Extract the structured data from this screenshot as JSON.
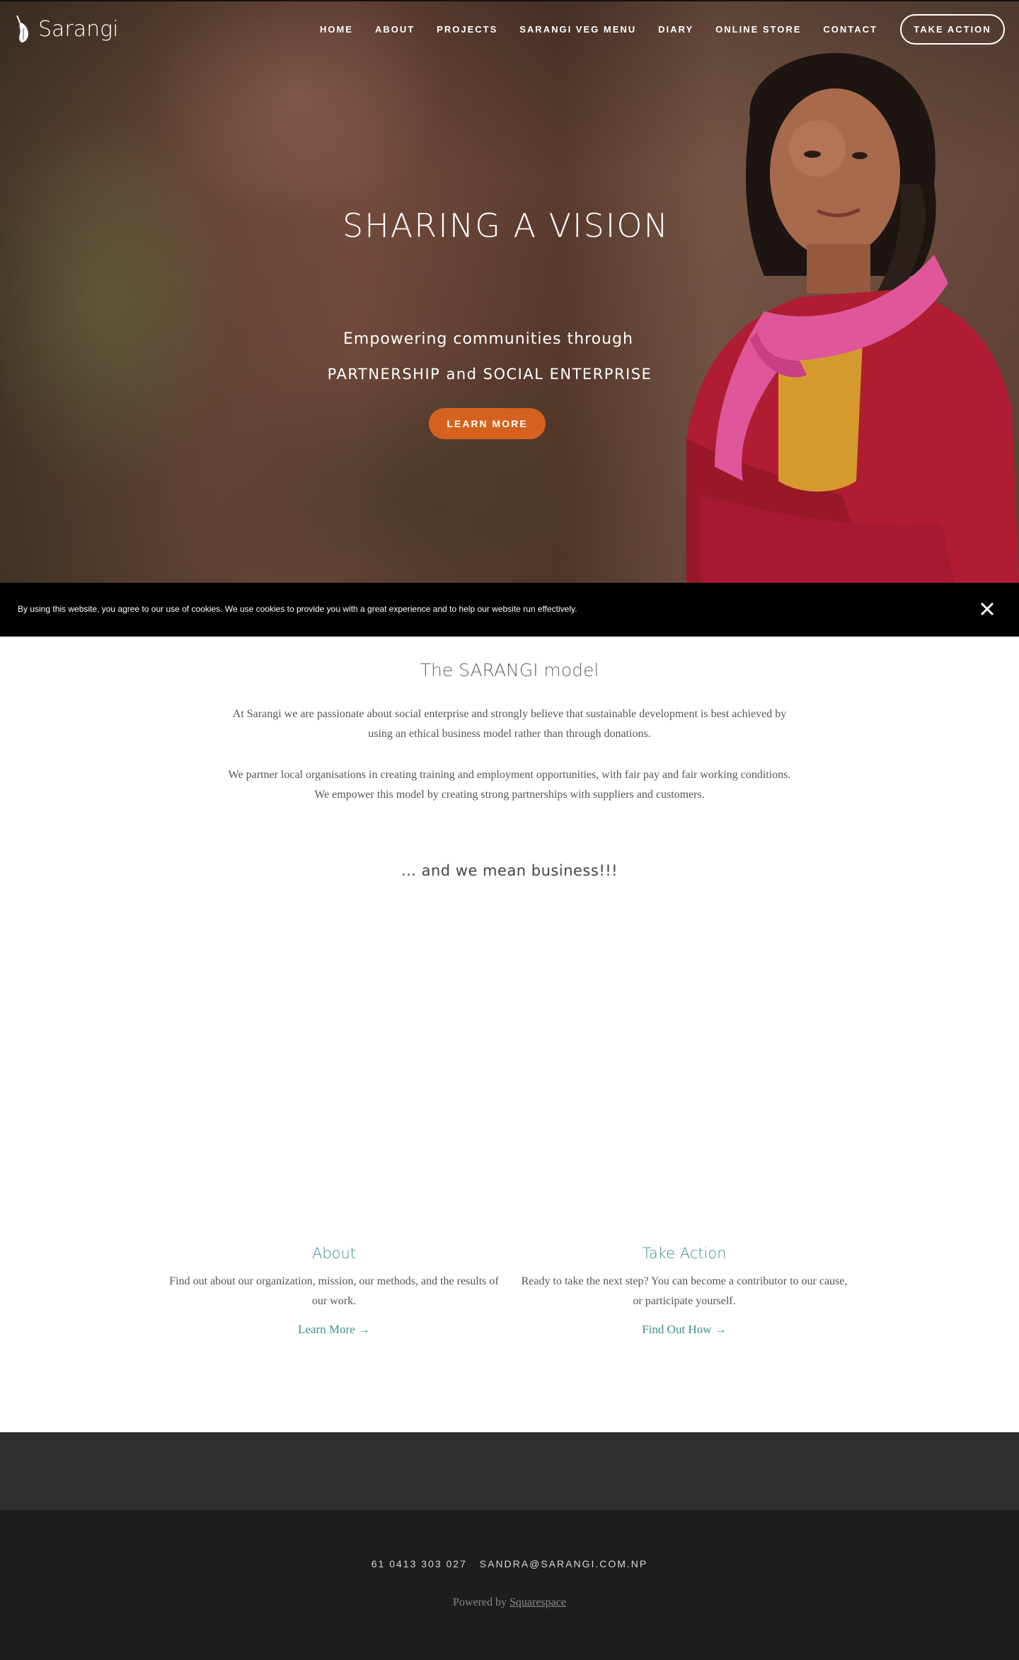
{
  "brand": {
    "name": "Sarangi"
  },
  "nav": {
    "items": [
      {
        "label": "HOME"
      },
      {
        "label": "ABOUT"
      },
      {
        "label": "PROJECTS"
      },
      {
        "label": "SARANGI VEG MENU"
      },
      {
        "label": "DIARY"
      },
      {
        "label": "ONLINE STORE"
      },
      {
        "label": "CONTACT"
      }
    ],
    "cta_label": "TAKE ACTION"
  },
  "hero": {
    "title": "SHARING A VISION",
    "subtitle_line1": "Empowering communities through",
    "subtitle_line2": "PARTNERSHIP and SOCIAL ENTERPRISE",
    "button_label": "LEARN MORE",
    "accent_color": "#d4621e"
  },
  "cookie": {
    "text": "By using this website, you agree to our use of cookies. We use cookies to provide you with a great experience and to help our website run effectively.",
    "close_icon": "close-icon"
  },
  "model": {
    "title": "The SARANGI model",
    "paragraph1": "At Sarangi we are passionate about social enterprise and strongly believe that sustainable development is best achieved by using an ethical business model rather than through donations.",
    "paragraph2": "We partner local organisations in creating training and employment opportunities, with fair pay and fair working conditions.  We empower this model by creating strong partnerships with suppliers and customers.",
    "tagline": "... and we mean business!!!"
  },
  "features": [
    {
      "title": "About",
      "text": "Find out about our organization, mission, our methods, and the results of our work.",
      "link": "Learn More →"
    },
    {
      "title": "Take Action",
      "text": "Ready to take the next step? You can become a contributor to our cause, or participate yourself.",
      "link": "Find Out How →"
    }
  ],
  "footer": {
    "phone": "61 0413 303 027",
    "email": "SANDRA@SARANGI.COM.NP",
    "powered_prefix": "Powered by",
    "powered_link": "Squarespace"
  },
  "colors": {
    "link_teal": "#3a9089",
    "footer_band": "#2f2f2f",
    "footer_bg": "#1d1d1d"
  }
}
